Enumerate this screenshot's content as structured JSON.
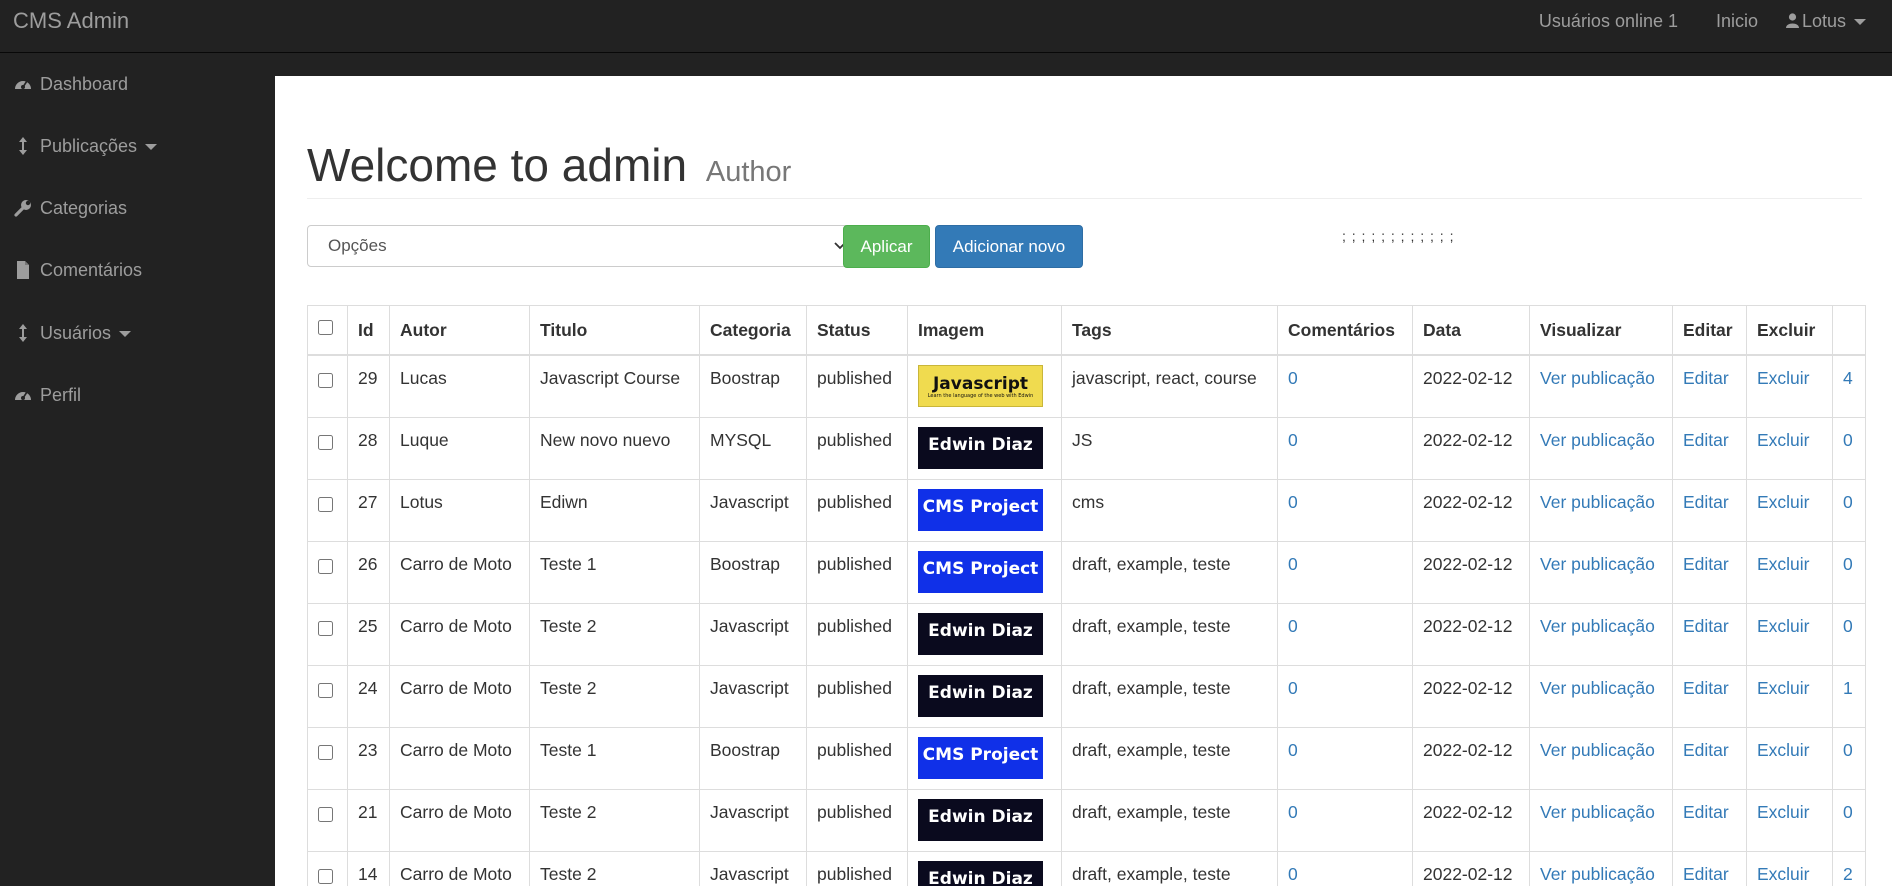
{
  "brand": "CMS Admin",
  "topnav": {
    "online": "Usuários online 1",
    "home": "Inicio",
    "user": "Lotus"
  },
  "sidebar": {
    "items": [
      {
        "label": "Dashboard",
        "icon": "dashboard-icon"
      },
      {
        "label": "Publicações",
        "icon": "arrows-v-icon",
        "dropdown": true
      },
      {
        "label": "Categorias",
        "icon": "wrench-icon"
      },
      {
        "label": "Comentários",
        "icon": "file-icon"
      },
      {
        "label": "Usuários",
        "icon": "arrows-v-icon",
        "dropdown": true
      },
      {
        "label": "Perfil",
        "icon": "dashboard-icon"
      }
    ]
  },
  "main": {
    "title": "Welcome to admin",
    "subtitle": "Author",
    "select_value": "Opções",
    "apply_label": "Aplicar",
    "add_label": "Adicionar novo",
    "dots": "; ; ; ; ; ; ; ; ; ; ; ;"
  },
  "table": {
    "headers": [
      "Id",
      "Autor",
      "Titulo",
      "Categoria",
      "Status",
      "Imagem",
      "Tags",
      "Comentários",
      "Data",
      "Visualizar",
      "Editar",
      "Excluir"
    ],
    "rows": [
      {
        "id": "29",
        "author": "Lucas",
        "title": "Javascript Course",
        "category": "Boostrap",
        "status": "published",
        "image": {
          "kind": "js",
          "text": "Javascript",
          "sub": "Learn the language of the web with Edwin"
        },
        "tags": "javascript, react, course",
        "comments": "0",
        "date": "2022-02-12",
        "view": "Ver publicação",
        "edit": "Editar",
        "delete": "Excluir",
        "extra": "4"
      },
      {
        "id": "28",
        "author": "Luque",
        "title": "New novo nuevo",
        "category": "MYSQL",
        "status": "published",
        "image": {
          "kind": "edwin",
          "text": "Edwin Diaz",
          "sub": ""
        },
        "tags": "JS",
        "comments": "0",
        "date": "2022-02-12",
        "view": "Ver publicação",
        "edit": "Editar",
        "delete": "Excluir",
        "extra": "0"
      },
      {
        "id": "27",
        "author": "Lotus",
        "title": "Ediwn",
        "category": "Javascript",
        "status": "published",
        "image": {
          "kind": "cms",
          "text": "CMS Project",
          "sub": ""
        },
        "tags": "cms",
        "comments": "0",
        "date": "2022-02-12",
        "view": "Ver publicação",
        "edit": "Editar",
        "delete": "Excluir",
        "extra": "0"
      },
      {
        "id": "26",
        "author": "Carro de Moto",
        "title": "Teste 1",
        "category": "Boostrap",
        "status": "published",
        "image": {
          "kind": "cms",
          "text": "CMS Project",
          "sub": ""
        },
        "tags": "draft, example, teste",
        "comments": "0",
        "date": "2022-02-12",
        "view": "Ver publicação",
        "edit": "Editar",
        "delete": "Excluir",
        "extra": "0"
      },
      {
        "id": "25",
        "author": "Carro de Moto",
        "title": "Teste 2",
        "category": "Javascript",
        "status": "published",
        "image": {
          "kind": "edwin",
          "text": "Edwin Diaz",
          "sub": ""
        },
        "tags": "draft, example, teste",
        "comments": "0",
        "date": "2022-02-12",
        "view": "Ver publicação",
        "edit": "Editar",
        "delete": "Excluir",
        "extra": "0"
      },
      {
        "id": "24",
        "author": "Carro de Moto",
        "title": "Teste 2",
        "category": "Javascript",
        "status": "published",
        "image": {
          "kind": "edwin",
          "text": "Edwin Diaz",
          "sub": ""
        },
        "tags": "draft, example, teste",
        "comments": "0",
        "date": "2022-02-12",
        "view": "Ver publicação",
        "edit": "Editar",
        "delete": "Excluir",
        "extra": "1"
      },
      {
        "id": "23",
        "author": "Carro de Moto",
        "title": "Teste 1",
        "category": "Boostrap",
        "status": "published",
        "image": {
          "kind": "cms",
          "text": "CMS Project",
          "sub": ""
        },
        "tags": "draft, example, teste",
        "comments": "0",
        "date": "2022-02-12",
        "view": "Ver publicação",
        "edit": "Editar",
        "delete": "Excluir",
        "extra": "0"
      },
      {
        "id": "21",
        "author": "Carro de Moto",
        "title": "Teste 2",
        "category": "Javascript",
        "status": "published",
        "image": {
          "kind": "edwin",
          "text": "Edwin Diaz",
          "sub": ""
        },
        "tags": "draft, example, teste",
        "comments": "0",
        "date": "2022-02-12",
        "view": "Ver publicação",
        "edit": "Editar",
        "delete": "Excluir",
        "extra": "0"
      },
      {
        "id": "14",
        "author": "Carro de Moto",
        "title": "Teste 2",
        "category": "Javascript",
        "status": "published",
        "image": {
          "kind": "edwin",
          "text": "Edwin Diaz",
          "sub": ""
        },
        "tags": "draft, example, teste",
        "comments": "0",
        "date": "2022-02-12",
        "view": "Ver publicação",
        "edit": "Editar",
        "delete": "Excluir",
        "extra": "2"
      }
    ]
  },
  "colors": {
    "navbar": "#222222",
    "nav_text": "#9d9d9d",
    "link": "#337ab7",
    "success": "#5cb85c",
    "primary": "#337ab7"
  }
}
